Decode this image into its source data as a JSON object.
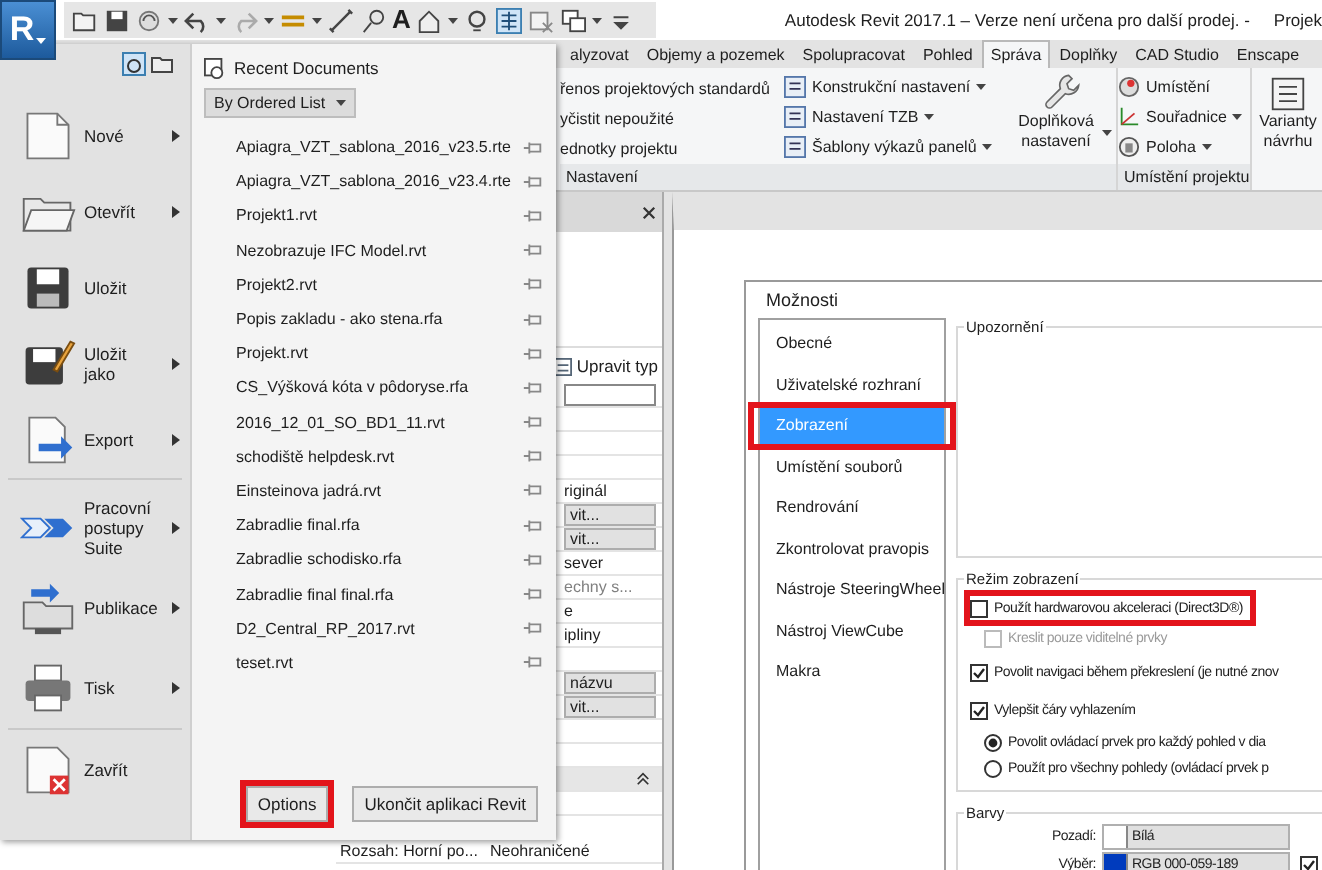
{
  "app_button": {
    "letter": "R"
  },
  "quick_access": {
    "text_tool": "A"
  },
  "window": {
    "title": "Autodesk Revit 2017.1 – Verze není určena pro další prodej. -",
    "title_continued": "Projek"
  },
  "ribbon": {
    "tabs": [
      {
        "label": "alyzovat",
        "selected": false
      },
      {
        "label": "Objemy a pozemek",
        "selected": false
      },
      {
        "label": "Spolupracovat",
        "selected": false
      },
      {
        "label": "Pohled",
        "selected": false
      },
      {
        "label": "Správa",
        "selected": true
      },
      {
        "label": "Doplňky",
        "selected": false
      },
      {
        "label": "CAD Studio",
        "selected": false
      },
      {
        "label": "Enscape",
        "selected": false
      }
    ],
    "settings_panel": {
      "label": "Nastavení",
      "commands": [
        "řenos projektových standardů",
        "yčistit nepoužité",
        "ednotky projektu"
      ],
      "mep_commands": [
        {
          "label": "Konstrukční nastavení",
          "dropdown": true
        },
        {
          "label": "Nastavení TZB",
          "dropdown": true
        },
        {
          "label": "Šablony výkazů panelů",
          "dropdown": true
        }
      ],
      "addins": {
        "label": "Doplňková nastavení",
        "dropdown": true
      }
    },
    "location_panel": {
      "label": "Umístění projektu",
      "commands": [
        {
          "kind": "location",
          "label": "Umístění",
          "dropdown": false
        },
        {
          "kind": "coordinates",
          "label": "Souřadnice",
          "dropdown": true
        },
        {
          "kind": "position",
          "label": "Poloha",
          "dropdown": true
        }
      ]
    },
    "design_options": {
      "label": "Varianty návrhu"
    }
  },
  "properties": {
    "edit_type": "Upravit typ",
    "rows": [
      {
        "kind": "field"
      },
      {
        "kind": "blank"
      },
      {
        "kind": "blank"
      },
      {
        "kind": "blank"
      },
      {
        "kind": "text",
        "value": "riginál"
      },
      {
        "kind": "button",
        "value": "vit..."
      },
      {
        "kind": "button",
        "value": "vit..."
      },
      {
        "kind": "text",
        "value": "sever"
      },
      {
        "kind": "muted",
        "value": "echny s..."
      },
      {
        "kind": "text",
        "value": "e"
      },
      {
        "kind": "text",
        "value": "ipliny"
      },
      {
        "kind": "blank"
      },
      {
        "kind": "button",
        "value": "názvu"
      },
      {
        "kind": "button",
        "value": "vit..."
      },
      {
        "kind": "blank"
      },
      {
        "kind": "blank"
      },
      {
        "kind": "header"
      },
      {
        "kind": "blank"
      }
    ],
    "bottom_row": {
      "label": "Rozsah: Horní po...",
      "value": "Neohraničené"
    }
  },
  "app_menu": {
    "command_groups": [
      [
        {
          "kind": "new",
          "label": "Nové",
          "submenu": true
        },
        {
          "kind": "open",
          "label": "Otevřít",
          "submenu": true
        },
        {
          "kind": "save",
          "label": "Uložit",
          "submenu": false
        },
        {
          "kind": "saveas",
          "label": "Uložit jako",
          "submenu": true
        },
        {
          "kind": "export",
          "label": "Export",
          "submenu": true
        }
      ],
      [
        {
          "kind": "workflow",
          "label": "Pracovní postupy Suite",
          "submenu": true
        },
        {
          "kind": "publish",
          "label": "Publikace",
          "submenu": true
        },
        {
          "kind": "print",
          "label": "Tisk",
          "submenu": true
        }
      ],
      [
        {
          "kind": "close",
          "label": "Zavřít",
          "submenu": false
        }
      ]
    ],
    "recent": {
      "title": "Recent Documents",
      "sort": "By Ordered List",
      "documents": [
        "Apiagra_VZT_sablona_2016_v23.5.rte",
        "Apiagra_VZT_sablona_2016_v23.4.rte",
        "Projekt1.rvt",
        "Nezobrazuje IFC Model.rvt",
        "Projekt2.rvt",
        "Popis zakladu - ako stena.rfa",
        "Projekt.rvt",
        "CS_Výšková kóta v pôdoryse.rfa",
        "2016_12_01_SO_BD1_11.rvt",
        "schodiště helpdesk.rvt",
        "Einsteinova jadrá.rvt",
        "Zabradlie final.rfa",
        "Zabradlie schodisko.rfa",
        "Zabradlie final final.rfa",
        "D2_Central_RP_2017.rvt",
        "teset.rvt"
      ]
    },
    "buttons": [
      {
        "label": "Options",
        "highlighted": true
      },
      {
        "label": "Ukončit aplikaci Revit",
        "highlighted": false
      }
    ]
  },
  "dialog": {
    "title": "Možnosti",
    "categories": [
      {
        "label": "Obecné",
        "selected": false,
        "highlighted": false
      },
      {
        "label": "Uživatelské rozhraní",
        "selected": false,
        "highlighted": false
      },
      {
        "label": "Zobrazení",
        "selected": true,
        "highlighted": true
      },
      {
        "label": "Umístění souborů",
        "selected": false,
        "highlighted": false
      },
      {
        "label": "Rendrování",
        "selected": false,
        "highlighted": false
      },
      {
        "label": "Zkontrolovat pravopis",
        "selected": false,
        "highlighted": false
      },
      {
        "label": "Nástroje SteeringWheel",
        "selected": false,
        "highlighted": false
      },
      {
        "label": "Nástroj ViewCube",
        "selected": false,
        "highlighted": false
      },
      {
        "label": "Makra",
        "selected": false,
        "highlighted": false
      }
    ],
    "warnings_group": {
      "legend": "Upozornění"
    },
    "display_group": {
      "legend": "Režim zobrazení",
      "options": [
        {
          "kind": "checkbox",
          "label": "Použít hardwarovou akceleraci (Direct3D®)",
          "checked": false,
          "disabled": false,
          "highlighted": true,
          "children": [
            {
              "kind": "checkbox",
              "label": "Kreslit pouze viditelné prvky",
              "checked": false,
              "disabled": true
            }
          ]
        },
        {
          "kind": "checkbox",
          "label": "Povolit navigaci během překreslení (je nutné znov",
          "checked": true,
          "disabled": false,
          "highlighted": false
        },
        {
          "kind": "checkbox",
          "label": "Vylepšit čáry vyhlazením",
          "checked": true,
          "disabled": false,
          "highlighted": false,
          "children": [
            {
              "kind": "radio",
              "label": "Povolit ovládací prvek pro každý pohled v dia",
              "selected": true
            },
            {
              "kind": "radio",
              "label": "Použít pro všechny pohledy (ovládací prvek p",
              "selected": false
            }
          ]
        }
      ]
    },
    "colors_group": {
      "legend": "Barvy",
      "rows": [
        {
          "label": "Pozadí:",
          "value": "Bílá",
          "color": "#ffffff"
        },
        {
          "label": "Výběr:",
          "value": "RGB 000-059-189",
          "color": "#003bbd"
        }
      ],
      "selection_option": {
        "checked": true
      }
    }
  }
}
